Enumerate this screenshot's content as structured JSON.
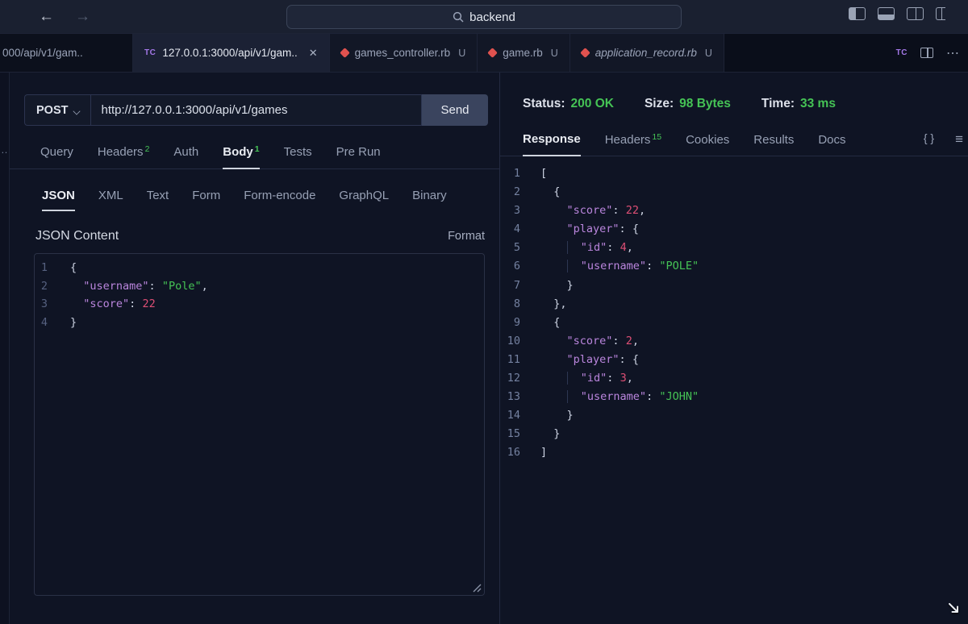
{
  "icons": {
    "back": "←",
    "forward": "→",
    "close": "✕",
    "more": "⋯",
    "braces": "{ }",
    "menu": "≡",
    "ellipsis": "…",
    "tc": "TC"
  },
  "titlebar": {
    "search_value": "backend"
  },
  "tabs": {
    "overflow_tab": "000/api/v1/gam..",
    "items": [
      {
        "label": "127.0.0.1:3000/api/v1/gam.."
      },
      {
        "label": "games_controller.rb",
        "badge": "U"
      },
      {
        "label": "game.rb",
        "badge": "U"
      },
      {
        "label": "application_record.rb",
        "badge": "U"
      }
    ]
  },
  "request": {
    "method": "POST",
    "url": "http://127.0.0.1:3000/api/v1/games",
    "send_label": "Send",
    "tabs": [
      {
        "label": "Query"
      },
      {
        "label": "Headers",
        "count": "2"
      },
      {
        "label": "Auth"
      },
      {
        "label": "Body",
        "count": "1"
      },
      {
        "label": "Tests"
      },
      {
        "label": "Pre Run"
      }
    ],
    "body_tabs": [
      {
        "label": "JSON"
      },
      {
        "label": "XML"
      },
      {
        "label": "Text"
      },
      {
        "label": "Form"
      },
      {
        "label": "Form-encode"
      },
      {
        "label": "GraphQL"
      },
      {
        "label": "Binary"
      }
    ],
    "content_title": "JSON Content",
    "format_label": "Format",
    "body_lines": [
      [
        [
          "p",
          "{"
        ]
      ],
      [
        [
          "w",
          "  "
        ],
        [
          "k",
          "\"username\""
        ],
        [
          "p",
          ": "
        ],
        [
          "s",
          "\"Pole\""
        ],
        [
          "p",
          ","
        ]
      ],
      [
        [
          "w",
          "  "
        ],
        [
          "k",
          "\"score\""
        ],
        [
          "p",
          ": "
        ],
        [
          "n",
          "22"
        ]
      ],
      [
        [
          "p",
          "}"
        ]
      ]
    ]
  },
  "response": {
    "status_label": "Status:",
    "status_value": "200 OK",
    "size_label": "Size:",
    "size_value": "98 Bytes",
    "time_label": "Time:",
    "time_value": "33 ms",
    "tabs": [
      {
        "label": "Response"
      },
      {
        "label": "Headers",
        "count": "15"
      },
      {
        "label": "Cookies"
      },
      {
        "label": "Results"
      },
      {
        "label": "Docs"
      }
    ],
    "body_lines": [
      [
        [
          "p",
          "["
        ]
      ],
      [
        [
          "w",
          "  "
        ],
        [
          "p",
          "{"
        ]
      ],
      [
        [
          "w",
          "    "
        ],
        [
          "k",
          "\"score\""
        ],
        [
          "p",
          ": "
        ],
        [
          "n",
          "22"
        ],
        [
          "p",
          ","
        ]
      ],
      [
        [
          "w",
          "    "
        ],
        [
          "k",
          "\"player\""
        ],
        [
          "p",
          ": "
        ],
        [
          "p",
          "{"
        ]
      ],
      [
        [
          "w",
          "    "
        ],
        [
          "g",
          "  "
        ],
        [
          "k",
          "\"id\""
        ],
        [
          "p",
          ": "
        ],
        [
          "n",
          "4"
        ],
        [
          "p",
          ","
        ]
      ],
      [
        [
          "w",
          "    "
        ],
        [
          "g",
          "  "
        ],
        [
          "k",
          "\"username\""
        ],
        [
          "p",
          ": "
        ],
        [
          "s",
          "\"POLE\""
        ]
      ],
      [
        [
          "w",
          "    "
        ],
        [
          "p",
          "}"
        ]
      ],
      [
        [
          "w",
          "  "
        ],
        [
          "p",
          "},"
        ]
      ],
      [
        [
          "w",
          "  "
        ],
        [
          "p",
          "{"
        ]
      ],
      [
        [
          "w",
          "    "
        ],
        [
          "k",
          "\"score\""
        ],
        [
          "p",
          ": "
        ],
        [
          "n",
          "2"
        ],
        [
          "p",
          ","
        ]
      ],
      [
        [
          "w",
          "    "
        ],
        [
          "k",
          "\"player\""
        ],
        [
          "p",
          ": "
        ],
        [
          "p",
          "{"
        ]
      ],
      [
        [
          "w",
          "    "
        ],
        [
          "g",
          "  "
        ],
        [
          "k",
          "\"id\""
        ],
        [
          "p",
          ": "
        ],
        [
          "n",
          "3"
        ],
        [
          "p",
          ","
        ]
      ],
      [
        [
          "w",
          "    "
        ],
        [
          "g",
          "  "
        ],
        [
          "k",
          "\"username\""
        ],
        [
          "p",
          ": "
        ],
        [
          "s",
          "\"JOHN\""
        ]
      ],
      [
        [
          "w",
          "    "
        ],
        [
          "p",
          "}"
        ]
      ],
      [
        [
          "w",
          "  "
        ],
        [
          "p",
          "}"
        ]
      ],
      [
        [
          "p",
          "]"
        ]
      ]
    ]
  }
}
